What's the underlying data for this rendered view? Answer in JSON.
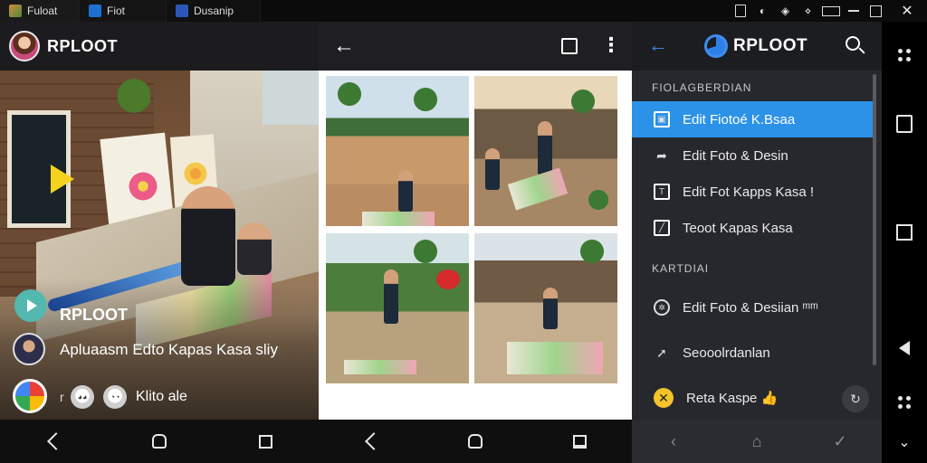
{
  "tabs": [
    {
      "label": "Fuloat"
    },
    {
      "label": "Fiot"
    },
    {
      "label": "Dusanip"
    }
  ],
  "panel1": {
    "title": "RPLOOT",
    "name": "RPLOOT",
    "description": "Apluaasm Edto Kapas Kasa sliy",
    "small_text": "r",
    "label": "Klito ale"
  },
  "panel3": {
    "title": "RPLOOT",
    "section1": "FIOLAGBERDIAN",
    "section2": "KARTDIAI",
    "items": [
      {
        "label": "Edit Fiotoé K.Bsaa",
        "icon": "edit-icon"
      },
      {
        "label": "Edit Foto & Desin",
        "icon": "share-icon"
      },
      {
        "label": "Edit Fot Kapps Kasa !",
        "icon": "crop-icon"
      },
      {
        "label": "Teoot Kapas Kasa",
        "icon": "pencil-icon"
      },
      {
        "label": "Edit Foto & Desiian ᵐᵐ",
        "icon": "palette-icon"
      },
      {
        "label": "Seooolrdanlan",
        "icon": "arrow-icon"
      },
      {
        "label": "Reta Kaspe 👍",
        "icon": "star-icon"
      }
    ]
  }
}
